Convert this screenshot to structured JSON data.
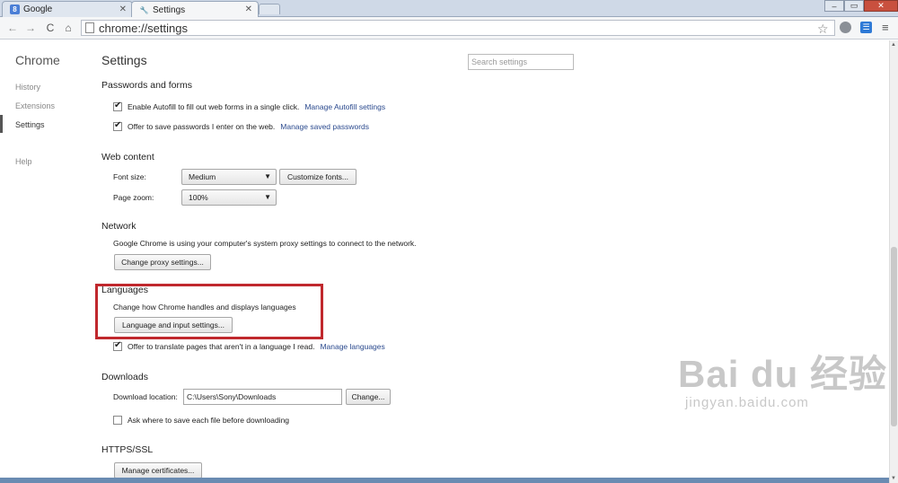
{
  "tabs": [
    {
      "label": "Google",
      "favicon": "8"
    },
    {
      "label": "Settings"
    }
  ],
  "window_controls": {
    "minimize": "‒",
    "maximize": "▭",
    "close": "✕"
  },
  "toolbar": {
    "back": "←",
    "forward": "→",
    "reload": "C",
    "home": "⌂",
    "url": "chrome://settings",
    "star": "☆",
    "ext_label": "☰",
    "menu": "≡"
  },
  "sidebar": {
    "brand": "Chrome",
    "items": [
      {
        "label": "History"
      },
      {
        "label": "Extensions"
      },
      {
        "label": "Settings",
        "active": true
      },
      {
        "label": "Help"
      }
    ]
  },
  "page": {
    "title": "Settings",
    "search_placeholder": "Search settings"
  },
  "passwords": {
    "heading": "Passwords and forms",
    "autofill_label": "Enable Autofill to fill out web forms in a single click.",
    "autofill_link": "Manage Autofill settings",
    "save_pw_label": "Offer to save passwords I enter on the web.",
    "save_pw_link": "Manage saved passwords"
  },
  "web_content": {
    "heading": "Web content",
    "font_size_label": "Font size:",
    "font_size_value": "Medium",
    "customize_fonts": "Customize fonts...",
    "page_zoom_label": "Page zoom:",
    "page_zoom_value": "100%"
  },
  "network": {
    "heading": "Network",
    "description": "Google Chrome is using your computer's system proxy settings to connect to the network.",
    "proxy_button": "Change proxy settings..."
  },
  "languages": {
    "heading": "Languages",
    "description": "Change how Chrome handles and displays languages",
    "input_button": "Language and input settings...",
    "translate_label": "Offer to translate pages that aren't in a language I read.",
    "translate_link": "Manage languages"
  },
  "downloads": {
    "heading": "Downloads",
    "location_label": "Download location:",
    "location_value": "C:\\Users\\Sony\\Downloads",
    "change_button": "Change...",
    "ask_label": "Ask where to save each file before downloading"
  },
  "https": {
    "heading": "HTTPS/SSL",
    "certs_button": "Manage certificates..."
  },
  "watermark": {
    "main": "Bai du 经验",
    "sub": "jingyan.baidu.com"
  },
  "colors": {
    "highlight": "#c0282d",
    "link": "#2b4a8e"
  }
}
